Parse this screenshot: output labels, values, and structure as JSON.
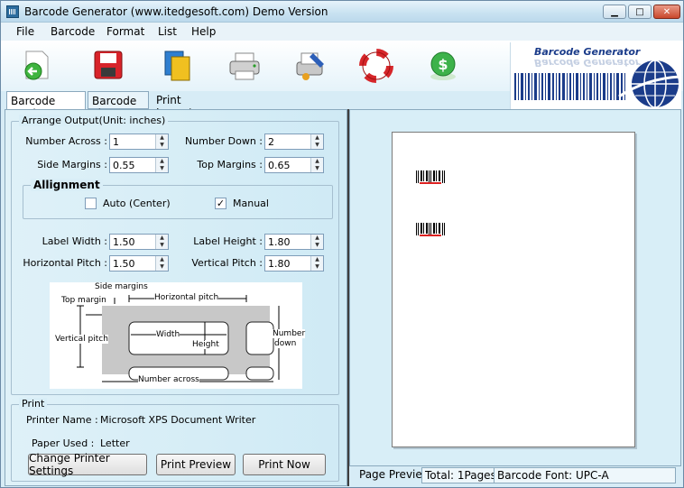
{
  "window": {
    "title": "Barcode Generator (www.itedgesoft.com) Demo Version"
  },
  "menu": [
    "File",
    "Barcode",
    "Format",
    "List",
    "Help"
  ],
  "toolbar": {
    "icons": [
      "back-icon",
      "save-icon",
      "copy-icon",
      "printer-icon",
      "print-setup-icon",
      "help-icon",
      "buy-icon"
    ],
    "banner_text": "Barcode Generator"
  },
  "tabs": [
    "Barcode Setting",
    "Barcode List",
    "Print Layout"
  ],
  "arrange": {
    "title": "Arrange Output(Unit: inches)",
    "number_across_label": "Number Across :",
    "number_across": "1",
    "number_down_label": "Number Down :",
    "number_down": "2",
    "side_margins_label": "Side Margins :",
    "side_margins": "0.55",
    "top_margins_label": "Top Margins :",
    "top_margins": "0.65",
    "alignment_title": "Allignment",
    "auto_label": "Auto (Center)",
    "auto_checked": false,
    "manual_label": "Manual",
    "manual_checked": true,
    "label_width_label": "Label Width :",
    "label_width": "1.50",
    "label_height_label": "Label Height :",
    "label_height": "1.80",
    "h_pitch_label": "Horizontal Pitch :",
    "h_pitch": "1.50",
    "v_pitch_label": "Vertical Pitch :",
    "v_pitch": "1.80"
  },
  "diagram": {
    "side_margins": "Side margins",
    "top_margin": "Top margin",
    "horizontal_pitch": "Horizontal pitch",
    "vertical_pitch": "Vertical pitch",
    "width": "Width",
    "height": "Height",
    "number_down_1": "Number",
    "number_down_2": "down",
    "number_across": "Number across"
  },
  "print": {
    "title": "Print",
    "printer_name_label": "Printer Name :",
    "printer_name": "Microsoft XPS Document Writer",
    "paper_used_label": "Paper Used :",
    "paper_used": "Letter",
    "change_btn": "Change Printer Settings",
    "preview_btn": "Print Preview",
    "now_btn": "Print Now"
  },
  "status": {
    "page_preview": "Page Preview",
    "total": "Total: 1Pages",
    "font": "Barcode Font: UPC-A"
  }
}
